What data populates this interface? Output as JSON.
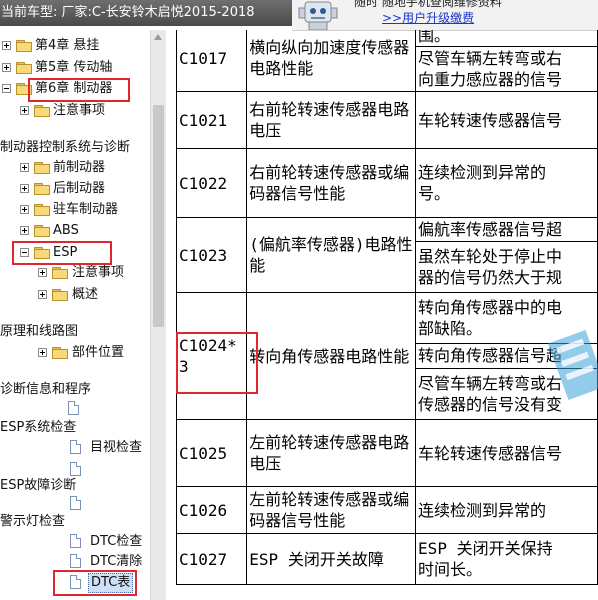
{
  "header": {
    "vehicle_text": "当前车型:  厂家:C-长安铃木启悦2015-2018"
  },
  "promo": {
    "line1": "随时 随地手机查阅维修资料",
    "link": ">>用户升级缴费"
  },
  "tree": [
    {
      "label": "第4章 悬挂",
      "icon": "folder-icon"
    },
    {
      "label": "第5章 传动轴",
      "icon": "folder-icon"
    },
    {
      "label": "第6章 制动器",
      "icon": "folder-icon"
    },
    {
      "label": "注意事项",
      "icon": "folder-icon"
    },
    {
      "label": "制动器控制系统与诊断",
      "icon": ""
    },
    {
      "label": "前制动器",
      "icon": "folder-icon"
    },
    {
      "label": "后制动器",
      "icon": "folder-icon"
    },
    {
      "label": "驻车制动器",
      "icon": "folder-icon"
    },
    {
      "label": "ABS",
      "icon": "folder-icon"
    },
    {
      "label": "ESP",
      "icon": "folder-icon"
    },
    {
      "label": "注意事项",
      "icon": "folder-icon"
    },
    {
      "label": "概述",
      "icon": "folder-icon"
    },
    {
      "label": "原理和线路图",
      "icon": ""
    },
    {
      "label": "部件位置",
      "icon": "folder-icon"
    },
    {
      "label": "诊断信息和程序",
      "icon": ""
    },
    {
      "label": "ESP系统检查",
      "icon": ""
    },
    {
      "label": "目视检查",
      "icon": "document-icon"
    },
    {
      "label": "ESP故障诊断",
      "icon": ""
    },
    {
      "label": "警示灯检查",
      "icon": ""
    },
    {
      "label": "DTC检查",
      "icon": "document-icon"
    },
    {
      "label": "DTC清除",
      "icon": "document-icon"
    },
    {
      "label": "DTC表",
      "icon": "document-icon"
    }
  ],
  "dtc_table": {
    "rows": [
      {
        "code": "C1017",
        "name": "横向纵向加速度传感器电路性能",
        "desc": [
          "围。",
          "尽管车辆左转弯或右",
          "向重力感应器的信号"
        ]
      },
      {
        "code": "C1021",
        "name": "右前轮转速传感器电路电压",
        "desc": [
          "车轮转速传感器信号"
        ]
      },
      {
        "code": "C1022",
        "name": "右前轮转速传感器或编码器信号性能",
        "desc": [
          "连续检测到异常的",
          "号。"
        ]
      },
      {
        "code": "C1023",
        "name": "(偏航率传感器)电路性能",
        "desc": [
          "偏航率传感器信号超",
          "虽然车轮处于停止中",
          "器的信号仍然大于规"
        ]
      },
      {
        "code": "C1024*3",
        "name": "转向角传感器电路性能",
        "desc": [
          "转向角传感器中的电",
          "部缺陷。",
          "转向角传感器信号超",
          "尽管车辆左转弯或右",
          "传感器的信号没有变"
        ]
      },
      {
        "code": "C1025",
        "name": "左前轮转速传感器电路电压",
        "desc": [
          "车轮转速传感器信号"
        ]
      },
      {
        "code": "C1026",
        "name": "左前轮转速传感器或编码器信号性能",
        "desc": [
          "连续检测到异常的"
        ]
      },
      {
        "code": "C1027",
        "name": "ESP  关闭开关故障",
        "desc": [
          "ESP  关闭开关保持",
          "时间长。"
        ]
      }
    ]
  },
  "colors": {
    "highlight_box": "#e0262e",
    "folder": "#f7d97a",
    "link": "#1a37c8"
  }
}
